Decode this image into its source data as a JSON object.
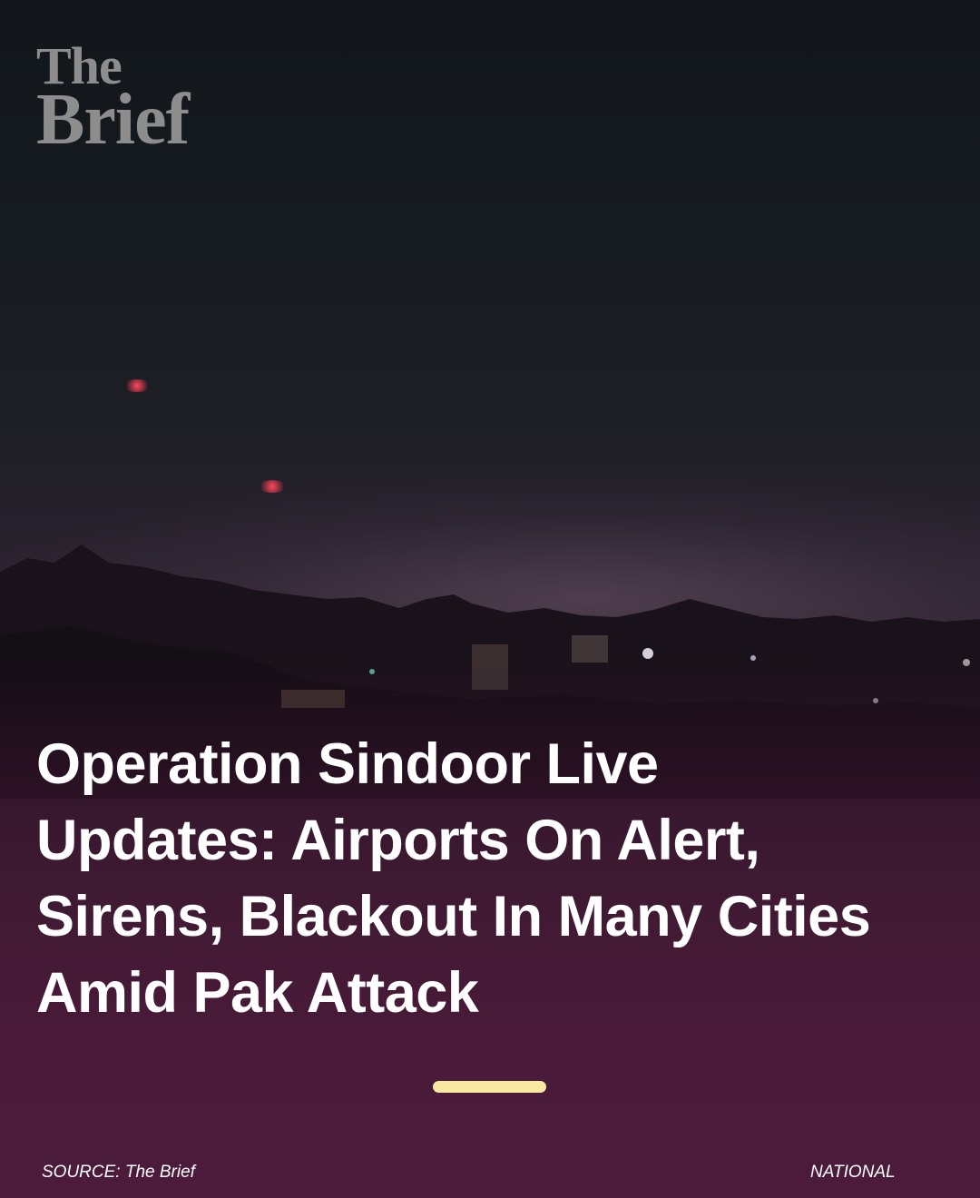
{
  "logo": {
    "line1": "The",
    "line2": "Brief"
  },
  "headline": "Operation Sindoor Live Updates:  Airports On Alert, Sirens, Blackout In Many Cities Amid Pak Attack",
  "footer": {
    "source": "SOURCE: The Brief",
    "category": "NATIONAL"
  },
  "colors": {
    "accent_bar": "#f8e9a0",
    "logo": "#8d8d8d",
    "text": "#ffffff",
    "bottom_tint": "#4e1d3d"
  }
}
